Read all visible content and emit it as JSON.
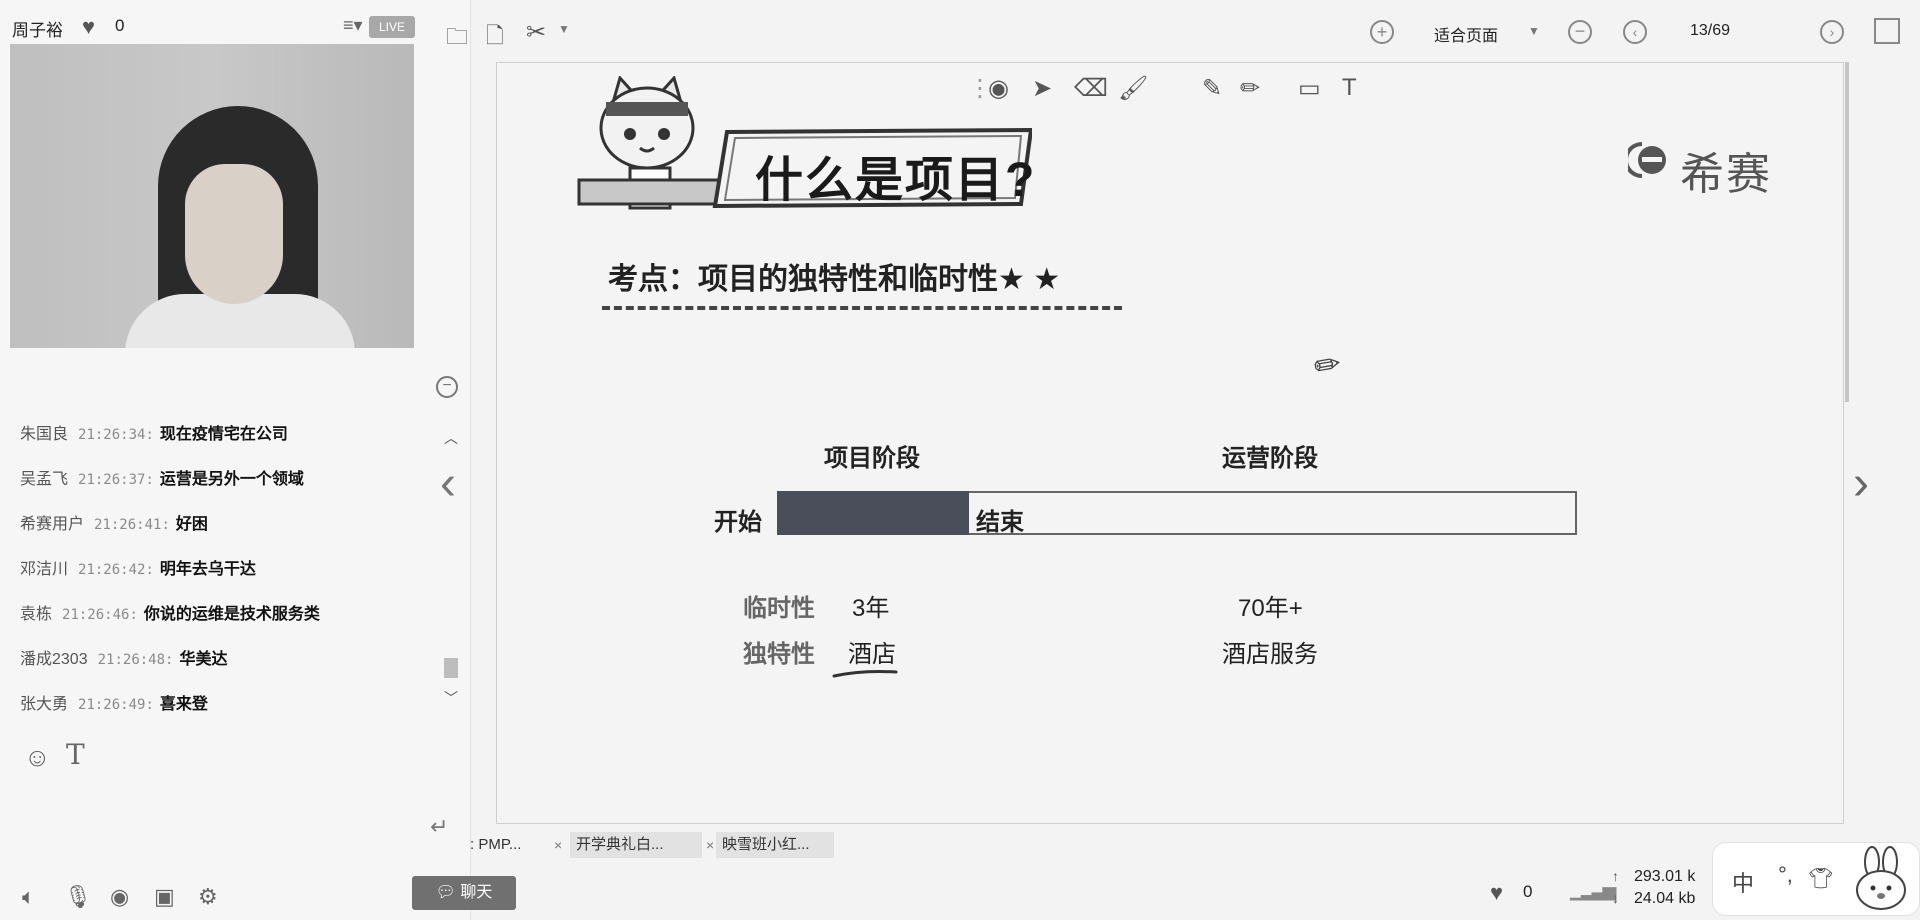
{
  "host": {
    "name": "周子裕",
    "likes": "0",
    "live_badge": "LIVE"
  },
  "chat": {
    "messages": [
      {
        "user": "朱国良",
        "time": "21:26:34:",
        "text": "现在疫情宅在公司"
      },
      {
        "user": "吴孟飞",
        "time": "21:26:37:",
        "text": "运营是另外一个领域"
      },
      {
        "user": "希赛用户",
        "time": "21:26:41:",
        "text": "好困"
      },
      {
        "user": "邓洁川",
        "time": "21:26:42:",
        "text": "明年去乌干达"
      },
      {
        "user": "袁栋",
        "time": "21:26:46:",
        "text": "你说的运维是技术服务类"
      },
      {
        "user": "潘成2303",
        "time": "21:26:48:",
        "text": "华美达"
      },
      {
        "user": "张大勇",
        "time": "21:26:49:",
        "text": "喜来登"
      }
    ],
    "chat_button": "聊天"
  },
  "toolbar": {
    "fit_page": "适合页面",
    "page_indicator": "13/69"
  },
  "slide": {
    "title": "什么是项目?",
    "brand": "希赛",
    "exam_point": "考点：项目的独特性和临时性★ ★",
    "project_phase": "项目阶段",
    "ops_phase": "运营阶段",
    "start": "开始",
    "end": "结束",
    "project_phase_share": 0.24,
    "rows": [
      {
        "label": "临时性",
        "project": "3年",
        "ops": "70年+"
      },
      {
        "label": "独特性",
        "project": "酒店",
        "ops": "酒店服务"
      }
    ]
  },
  "tabs": [
    {
      "label": ": PMP..."
    },
    {
      "label": "开学典礼白..."
    },
    {
      "label": "映雪班小红..."
    }
  ],
  "status": {
    "likes": "0",
    "upload": "293.01 k",
    "download": "24.04 kb"
  },
  "ime": {
    "mode": "中",
    "punct": "°,"
  },
  "colors": {
    "timeline_fill": "#4a4e5a",
    "live_badge_bg": "#a8a8a8",
    "chat_button_bg": "#707070"
  }
}
